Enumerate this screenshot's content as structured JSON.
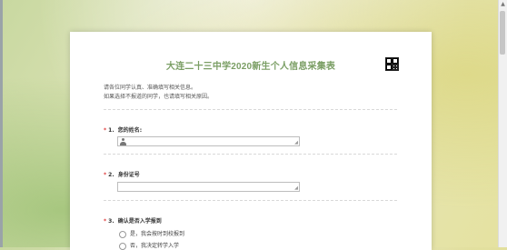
{
  "form": {
    "title": "大连二十三中学2020新生个人信息采集表",
    "intro_line1": "请各位同学认真、准确填写相关信息。",
    "intro_line2": "如果选择不报道的同学，也请填写相关原因。"
  },
  "questions": [
    {
      "required": "*",
      "number": "1.",
      "label": "您的姓名:",
      "icon": "person-icon"
    },
    {
      "required": "*",
      "number": "2.",
      "label": "身份证号"
    },
    {
      "required": "*",
      "number": "3.",
      "label": "确认是否入学报到",
      "options": [
        "是，我会按时到校报到",
        "否，我决定转学入学"
      ]
    }
  ],
  "colors": {
    "title": "#7a9e64",
    "required": "#e04040"
  }
}
